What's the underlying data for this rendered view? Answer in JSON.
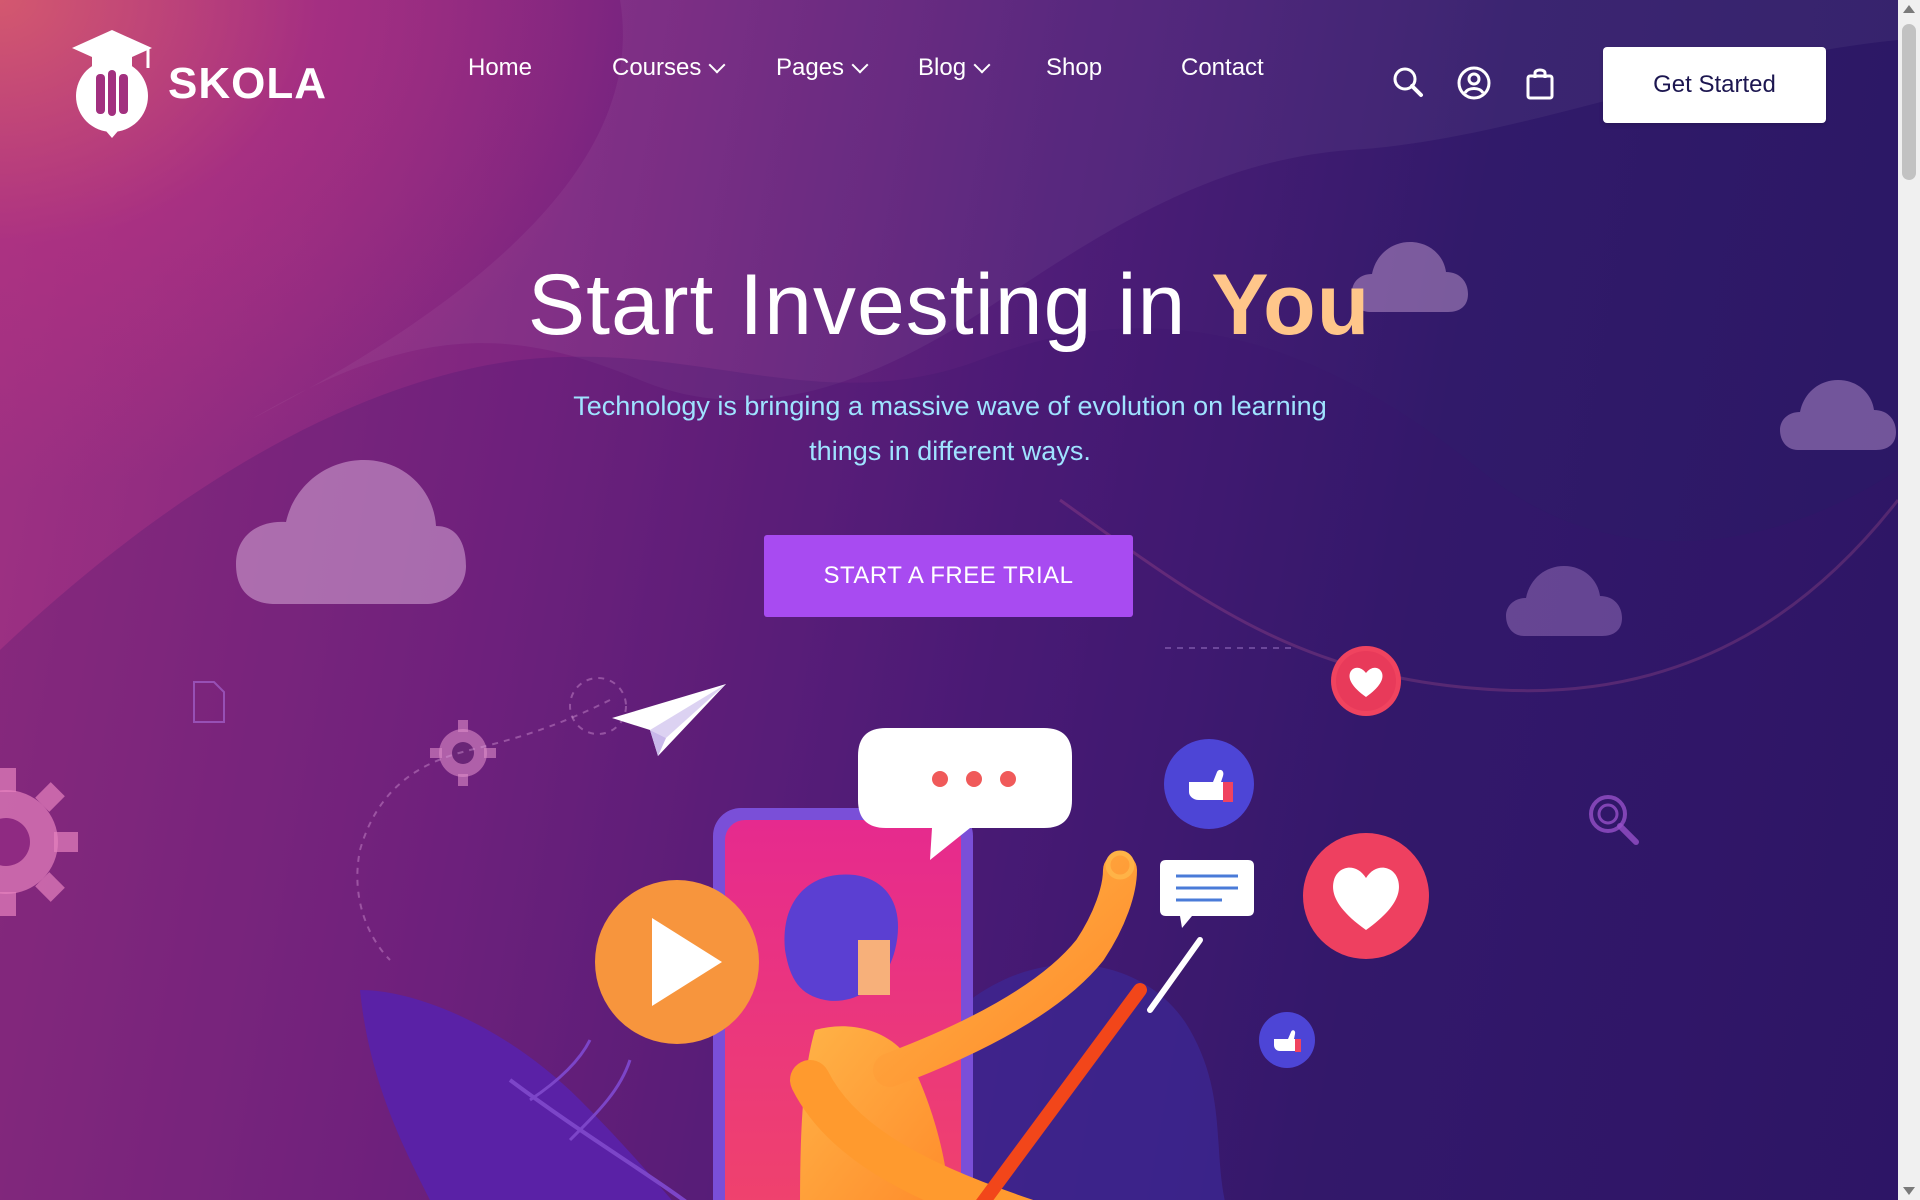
{
  "brand": {
    "name": "SKOLA"
  },
  "nav": {
    "items": [
      {
        "label": "Home",
        "has_dropdown": false
      },
      {
        "label": "Courses",
        "has_dropdown": true
      },
      {
        "label": "Pages",
        "has_dropdown": true
      },
      {
        "label": "Blog",
        "has_dropdown": true
      },
      {
        "label": "Shop",
        "has_dropdown": false
      },
      {
        "label": "Contact",
        "has_dropdown": false
      }
    ],
    "icons": [
      "search-icon",
      "account-icon",
      "shopping-bag-icon"
    ],
    "cta_label": "Get Started"
  },
  "hero": {
    "headline_prefix": "Start Investing in ",
    "headline_highlight": "You",
    "subtext": "Technology is bringing a massive wave of evolution on learning things in different ways.",
    "cta_label": "START A FREE TRIAL"
  },
  "colors": {
    "accent_purple": "#a84bf1",
    "highlight_orange": "#ffc68a",
    "subtext_cyan": "#9fe3ff",
    "header_button_text": "#1c1650"
  }
}
